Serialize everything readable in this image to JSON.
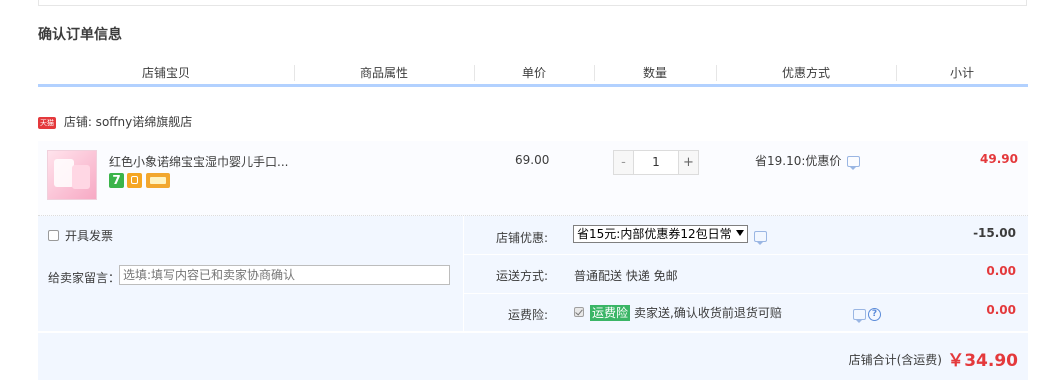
{
  "section_title": "确认订单信息",
  "table_headers": [
    "店铺宝贝",
    "商品属性",
    "单价",
    "数量",
    "优惠方式",
    "小计"
  ],
  "shop": {
    "badge": "天猫",
    "label": "店铺: soffny诺绵旗舰店"
  },
  "item": {
    "name": "红色小象诺绵宝宝湿巾婴儿手口...",
    "badge_seven": "7",
    "unit_price": "69.00",
    "quantity": "1",
    "qty_minus": "-",
    "qty_plus": "+",
    "promotion": "省19.10:优惠价",
    "subtotal": "49.90"
  },
  "invoice": {
    "label": "开具发票"
  },
  "memo": {
    "label": "给卖家留言：",
    "placeholder": "选填:填写内容已和卖家协商确认"
  },
  "shop_discount": {
    "label": "店铺优惠:",
    "selected": "省15元:内部优惠券12包日常",
    "amount": "-15.00"
  },
  "shipping": {
    "label": "运送方式:",
    "value": "普通配送 快递 免邮",
    "amount": "0.00"
  },
  "insurance": {
    "label": "运费险:",
    "tag": "运费险",
    "text": "卖家送,确认收货前退货可赔",
    "amount": "0.00"
  },
  "shop_total": {
    "label": "店铺合计(含运费)",
    "amount": "￥34.90"
  },
  "colors": {
    "price_red": "#e4393c",
    "header_border": "#b2d1ff",
    "panel_bg": "#f2f7ff",
    "insurance_green": "#3ab566"
  }
}
